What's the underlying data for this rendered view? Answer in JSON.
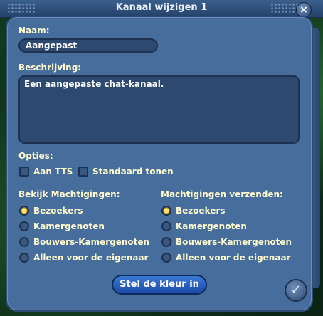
{
  "window": {
    "title": "Kanaal wijzigen 1",
    "close_glyph": "×"
  },
  "form": {
    "name_label": "Naam:",
    "name_value": "Aangepast",
    "desc_label": "Beschrijving:",
    "desc_value": "Een aangepaste chat-kanaal.",
    "options_label": "Opties:",
    "options": [
      {
        "label": "Aan TTS",
        "checked": false
      },
      {
        "label": "Standaard tonen",
        "checked": false
      }
    ],
    "view_perms": {
      "label": "Bekijk Machtigingen:",
      "items": [
        "Bezoekers",
        "Kamergenoten",
        "Bouwers-Kamergenoten",
        "Alleen voor de eigenaar"
      ],
      "selected": 0
    },
    "send_perms": {
      "label": "Machtigingen verzenden:",
      "items": [
        "Bezoekers",
        "Kamergenoten",
        "Bouwers-Kamergenoten",
        "Alleen voor de eigenaar"
      ],
      "selected": 0
    },
    "color_button": "Stel de kleur in",
    "ok_glyph": "✓"
  }
}
